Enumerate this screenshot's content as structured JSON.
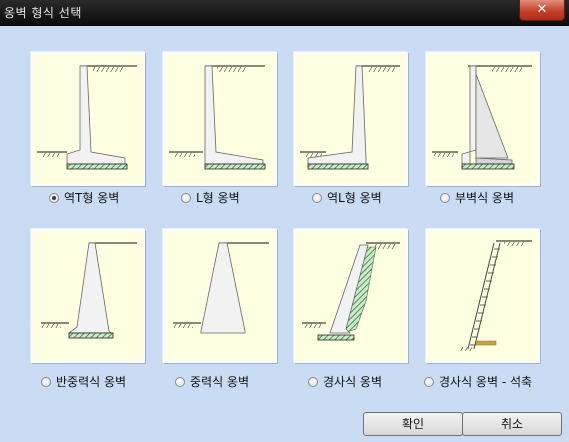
{
  "window": {
    "title": "옹벽 형식 선택",
    "close_glyph": "✕"
  },
  "options": [
    {
      "label": "역T형 옹벽",
      "selected": true
    },
    {
      "label": "L형 옹벽",
      "selected": false
    },
    {
      "label": "역L형 옹벽",
      "selected": false
    },
    {
      "label": "부벽식 옹벽",
      "selected": false
    },
    {
      "label": "반중력식 옹벽",
      "selected": false
    },
    {
      "label": "중력식 옹벽",
      "selected": false
    },
    {
      "label": "경사식 옹벽",
      "selected": false
    },
    {
      "label": "경사식 옹벽 - 석축",
      "selected": false
    }
  ],
  "buttons": {
    "ok": "확인",
    "cancel": "취소"
  },
  "colors": {
    "thumb_bg": "#ffffe1",
    "wall_fill": "#f0f0f0",
    "footing_hatch": "#2e7d32",
    "dialog_bg": "#c9dcf4"
  }
}
